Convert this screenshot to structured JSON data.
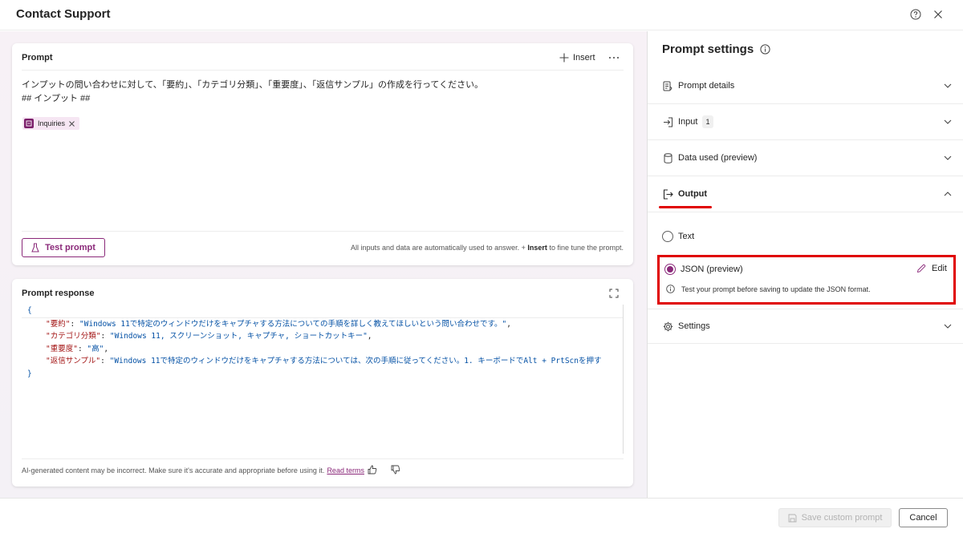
{
  "window": {
    "title": "Contact Support"
  },
  "prompt": {
    "title": "Prompt",
    "insert_label": "Insert",
    "line1": "インプットの問い合わせに対して、「要約」、「カテゴリ分類」、「重要度」、「返信サンプル」の作成を行ってください。",
    "line2": "## インプット ##",
    "chip_label": "Inquiries",
    "test_button": "Test prompt",
    "hint_pre": "All inputs and data are automatically used to answer. +",
    "hint_bold": "Insert",
    "hint_post": "to fine tune the prompt."
  },
  "response": {
    "title": "Prompt response",
    "code": {
      "open": "{",
      "rows": [
        {
          "key": "\"要約\"",
          "value": "\"Windows 11で特定のウィンドウだけをキャプチャする方法についての手順を詳しく教えてほしいという問い合わせです。\"",
          "end": ","
        },
        {
          "key": "\"カテゴリ分類\"",
          "value": "\"Windows 11, スクリーンショット, キャプチャ, ショートカットキー\"",
          "end": ","
        },
        {
          "key": "\"重要度\"",
          "value": "\"高\"",
          "end": ","
        },
        {
          "key": "\"返信サンプル\"",
          "value": "\"Windows 11で特定のウィンドウだけをキャプチャする方法については、次の手順に従ってください。1. キーボードでAlt + PrtScnを押す",
          "end": ""
        }
      ],
      "close": "}"
    },
    "disclaimer": "AI-generated content may be incorrect. Make sure it's accurate and appropriate before using it.",
    "read_terms": "Read terms"
  },
  "settings": {
    "title": "Prompt settings",
    "sections": {
      "prompt_details": "Prompt details",
      "input": "Input",
      "input_count": "1",
      "data_used": "Data used (preview)",
      "output": "Output",
      "settings": "Settings"
    },
    "output_options": {
      "text": "Text",
      "json": "JSON (preview)",
      "edit": "Edit",
      "json_info": "Test your prompt before saving to update the JSON format."
    }
  },
  "footer": {
    "save": "Save custom prompt",
    "cancel": "Cancel"
  },
  "colors": {
    "accent": "#8a2879",
    "highlight": "#e00000"
  }
}
